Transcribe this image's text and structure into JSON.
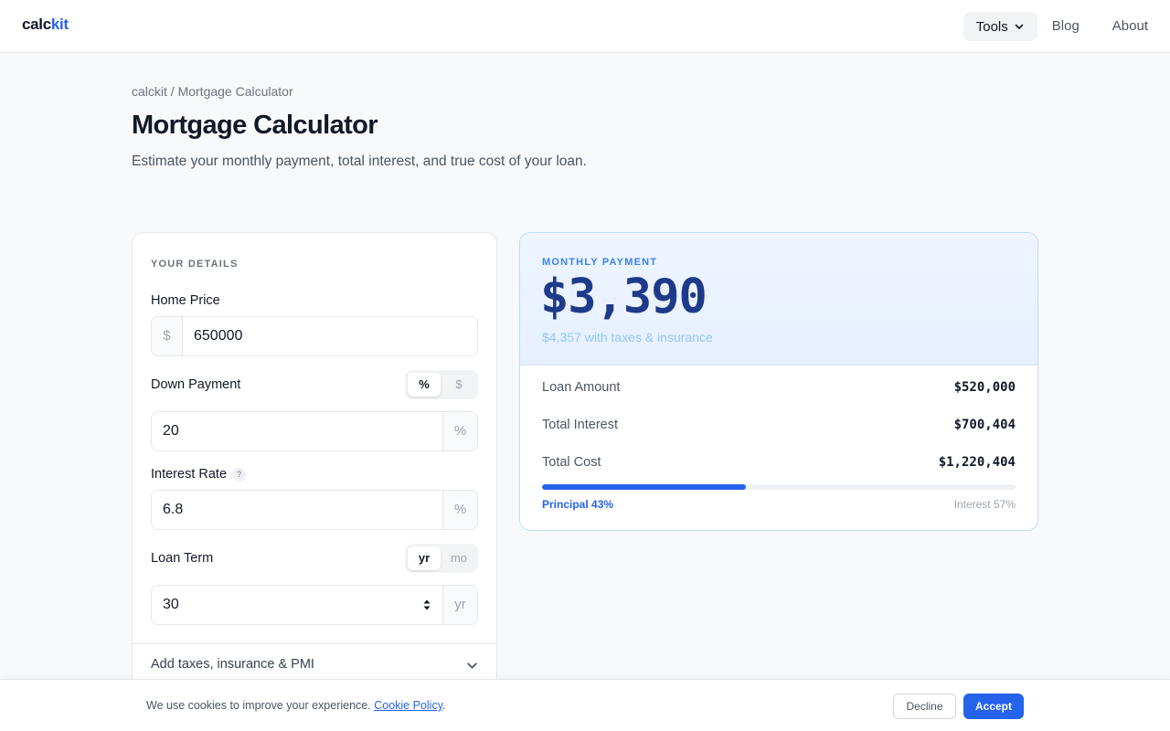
{
  "header": {
    "logo_main": "calc",
    "logo_accent": "kit",
    "nav": {
      "tools_label": "Tools",
      "blog_label": "Blog",
      "about_label": "About"
    }
  },
  "breadcrumb": "calckit / Mortgage Calculator",
  "page": {
    "title": "Mortgage Calculator",
    "description": "Estimate your monthly payment, total interest, and true cost of your loan."
  },
  "form": {
    "section_label": "YOUR DETAILS",
    "home_price": {
      "label": "Home Price",
      "prefix": "$",
      "value": "650000"
    },
    "down_payment": {
      "label": "Down Payment",
      "toggle": [
        "%",
        "$"
      ],
      "selected": "%",
      "value": "20",
      "suffix": "%"
    },
    "interest_rate": {
      "label": "Interest Rate",
      "help": "?",
      "value": "6.8",
      "suffix": "%"
    },
    "loan_term": {
      "label": "Loan Term",
      "toggle": [
        "yr",
        "mo"
      ],
      "selected": "yr",
      "value": "30",
      "suffix": "yr"
    },
    "extras_label": "Add taxes, insurance & PMI"
  },
  "results": {
    "label": "MONTHLY PAYMENT",
    "monthly_payment": "$3,390",
    "with_taxes": "$4,357 with taxes & insurance",
    "rows": [
      {
        "label": "Loan Amount",
        "value": "$520,000"
      },
      {
        "label": "Total Interest",
        "value": "$700,404"
      },
      {
        "label": "Total Cost",
        "value": "$1,220,404"
      }
    ],
    "principal_fraction": 0.43,
    "principal_label": "Principal 43%",
    "interest_label": "Interest 57%"
  },
  "cookie": {
    "text": "We use cookies to improve your experience.",
    "link_text": "Cookie Policy",
    "link_after": ".",
    "decline_label": "Decline",
    "accept_label": "Accept"
  },
  "colors": {
    "accent": "#2563eb",
    "hero_amount": "#1e3a8a"
  }
}
